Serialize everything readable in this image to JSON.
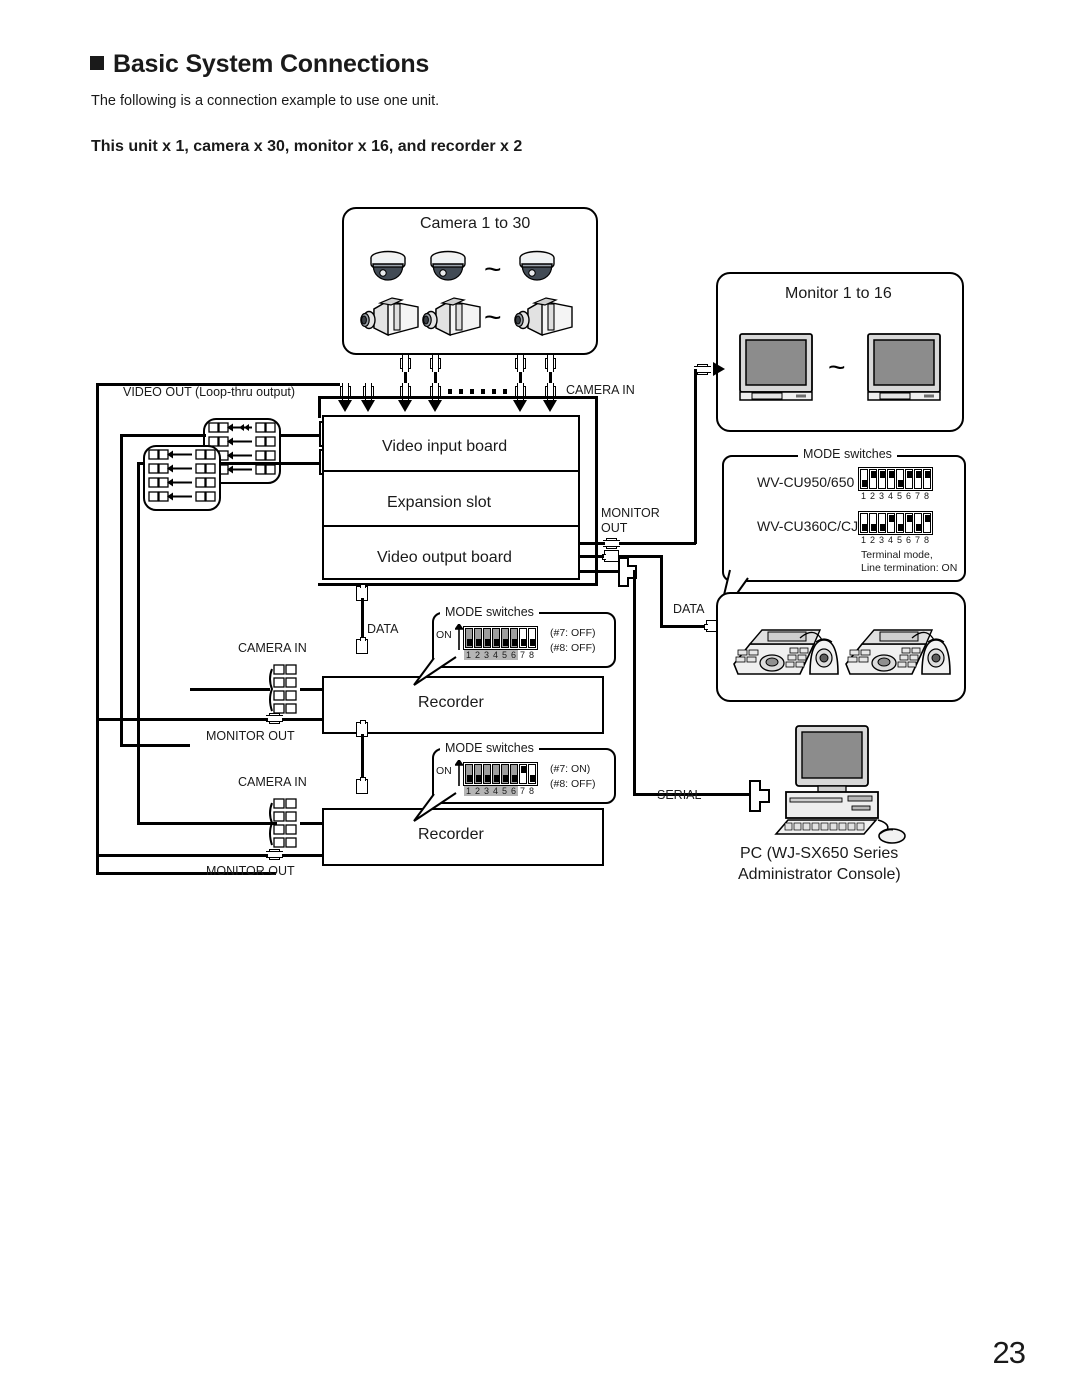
{
  "header": {
    "title": "Basic System Connections",
    "subtitle": "The following is a connection example to use one unit.",
    "config_line": "This unit x 1, camera x 30, monitor x 16, and recorder x 2"
  },
  "page_number": "23",
  "camera_box": {
    "title": "Camera 1 to 30",
    "tilde": "~"
  },
  "monitor_box": {
    "title": "Monitor 1 to 16",
    "tilde": "~"
  },
  "main_unit": {
    "rows": [
      {
        "label": "Video input board"
      },
      {
        "label": "Expansion slot"
      },
      {
        "label": "Video output board"
      }
    ],
    "labels": {
      "video_out": "VIDEO OUT (Loop-thru output)",
      "camera_in": "CAMERA IN",
      "monitor_out_line1": "MONITOR",
      "monitor_out_line2": "OUT",
      "data": "DATA",
      "serial": "SERIAL"
    }
  },
  "recorders": [
    {
      "name": "Recorder",
      "camera_in": "CAMERA IN",
      "monitor_out": "MONITOR OUT",
      "data": "DATA",
      "mode_switches": {
        "title": "MODE switches",
        "on_label": "ON",
        "numbers": [
          "1",
          "2",
          "3",
          "4",
          "5",
          "6",
          "7",
          "8"
        ],
        "states": [
          "dn",
          "dn",
          "dn",
          "dn",
          "dn",
          "dn",
          "dn",
          "dn"
        ],
        "shaded": [
          true,
          true,
          true,
          true,
          true,
          true,
          false,
          false
        ],
        "notes": [
          "(#7: OFF)",
          "(#8: OFF)"
        ]
      }
    },
    {
      "name": "Recorder",
      "camera_in": "CAMERA IN",
      "monitor_out": "MONITOR OUT",
      "mode_switches": {
        "title": "MODE switches",
        "on_label": "ON",
        "numbers": [
          "1",
          "2",
          "3",
          "4",
          "5",
          "6",
          "7",
          "8"
        ],
        "states": [
          "dn",
          "dn",
          "dn",
          "dn",
          "dn",
          "dn",
          "up",
          "dn"
        ],
        "shaded": [
          true,
          true,
          true,
          true,
          true,
          true,
          false,
          false
        ],
        "notes": [
          "(#7: ON)",
          "(#8: OFF)"
        ]
      }
    }
  ],
  "controller_mode_panel": {
    "title": "MODE switches",
    "rows": [
      {
        "label": "WV-CU950/650",
        "numbers": [
          "1",
          "2",
          "3",
          "4",
          "5",
          "6",
          "7",
          "8"
        ],
        "states": [
          "dn",
          "up",
          "up",
          "up",
          "dn",
          "up",
          "up",
          "up"
        ]
      },
      {
        "label": "WV-CU360C/CJ",
        "numbers": [
          "1",
          "2",
          "3",
          "4",
          "5",
          "6",
          "7",
          "8"
        ],
        "states": [
          "dn",
          "dn",
          "dn",
          "up",
          "dn",
          "up",
          "dn",
          "up"
        ]
      }
    ],
    "footnote_line1": "Terminal mode,",
    "footnote_line2": "Line termination: ON"
  },
  "controller_box": {
    "data_label": "DATA"
  },
  "pc": {
    "caption_line1": "PC (WJ-SX650 Series",
    "caption_line2": "Administrator Console)"
  },
  "colors": {
    "ink": "#1a1a1a",
    "screen_grey": "#8c8c8c",
    "switch_grey": "#9d9d9d",
    "bezel_grey": "#d8d8d8"
  }
}
